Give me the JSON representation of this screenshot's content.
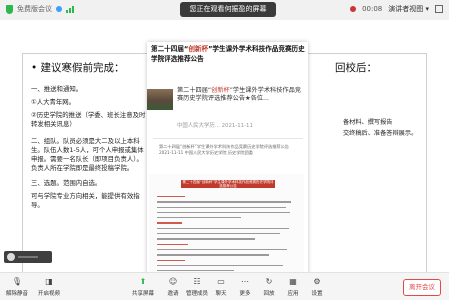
{
  "topbar": {
    "app_name": "免费版会议",
    "share_banner": "您正在观看何振盈的屏幕",
    "timer": "00:08",
    "view_mode": "演讲者视图"
  },
  "slide": {
    "left_title": "• 建议寒假前完成：",
    "left_paragraphs": [
      "一、推送和通知。",
      "①人大青年网。",
      "②历史学院的推送（学委、班长注意及时转发相关讯息）",
      "二、组队。队员必须是大二及以上本科生。队伍人数1-5人，可个人申报或集体申报。需要一名队长（即项目负责人）。负责人所在学院即是最终投稿学院。",
      "三、选题。范围内自选。",
      "可与学院专业方向相关，能提供有效指导。"
    ],
    "right_title": "回校后：",
    "right_lines": [
      "备材料、撰写报告",
      "交终稿后、准备答辩展示。"
    ]
  },
  "article": {
    "title_pre": "第二十四届“",
    "title_hl": "创新杯",
    "title_post": "”学生课外学术科技作品竞赛历史学院评选推荐公告",
    "sub_pre": "第二十四届“",
    "sub_hl": "创新杯",
    "sub_post": "”学生课外学术科技作品竞赛历史学院评选推荐公告★各位...",
    "source": "中国人民大学历... 2021-11-11",
    "mini_title": "第二十四届“创新杯”学生课外学术科技作品竞赛历史学院评选推荐公告",
    "mini_meta": "2021-11-11 中国人民大学历史学院 历史学院团委",
    "doc_header": "第二十四届“创新杯”学生课外学术科技作品竞赛历史学院评选推荐公告"
  },
  "toolbar": {
    "items": [
      {
        "label": "解除静音",
        "icon": "mic-muted-icon",
        "glyph": "🎙"
      },
      {
        "label": "开启视频",
        "icon": "camera-icon",
        "glyph": "◨"
      },
      {
        "label": "共享屏幕",
        "icon": "share-screen-icon",
        "glyph": "⬆"
      },
      {
        "label": "邀请",
        "icon": "invite-icon",
        "glyph": "☺"
      },
      {
        "label": "管理成员",
        "icon": "members-icon",
        "glyph": "☷"
      },
      {
        "label": "聊天",
        "icon": "chat-icon",
        "glyph": "▭"
      },
      {
        "label": "更多",
        "icon": "more-icon",
        "glyph": "⋯"
      },
      {
        "label": "回放",
        "icon": "replay-icon",
        "glyph": "↻"
      },
      {
        "label": "应用",
        "icon": "apps-icon",
        "glyph": "▦"
      },
      {
        "label": "设置",
        "icon": "settings-icon",
        "glyph": "⚙"
      }
    ],
    "end_label": "离开会议"
  },
  "colors": {
    "accent": "#2db84d",
    "danger": "#e24a4a",
    "highlight": "#c0392b"
  }
}
